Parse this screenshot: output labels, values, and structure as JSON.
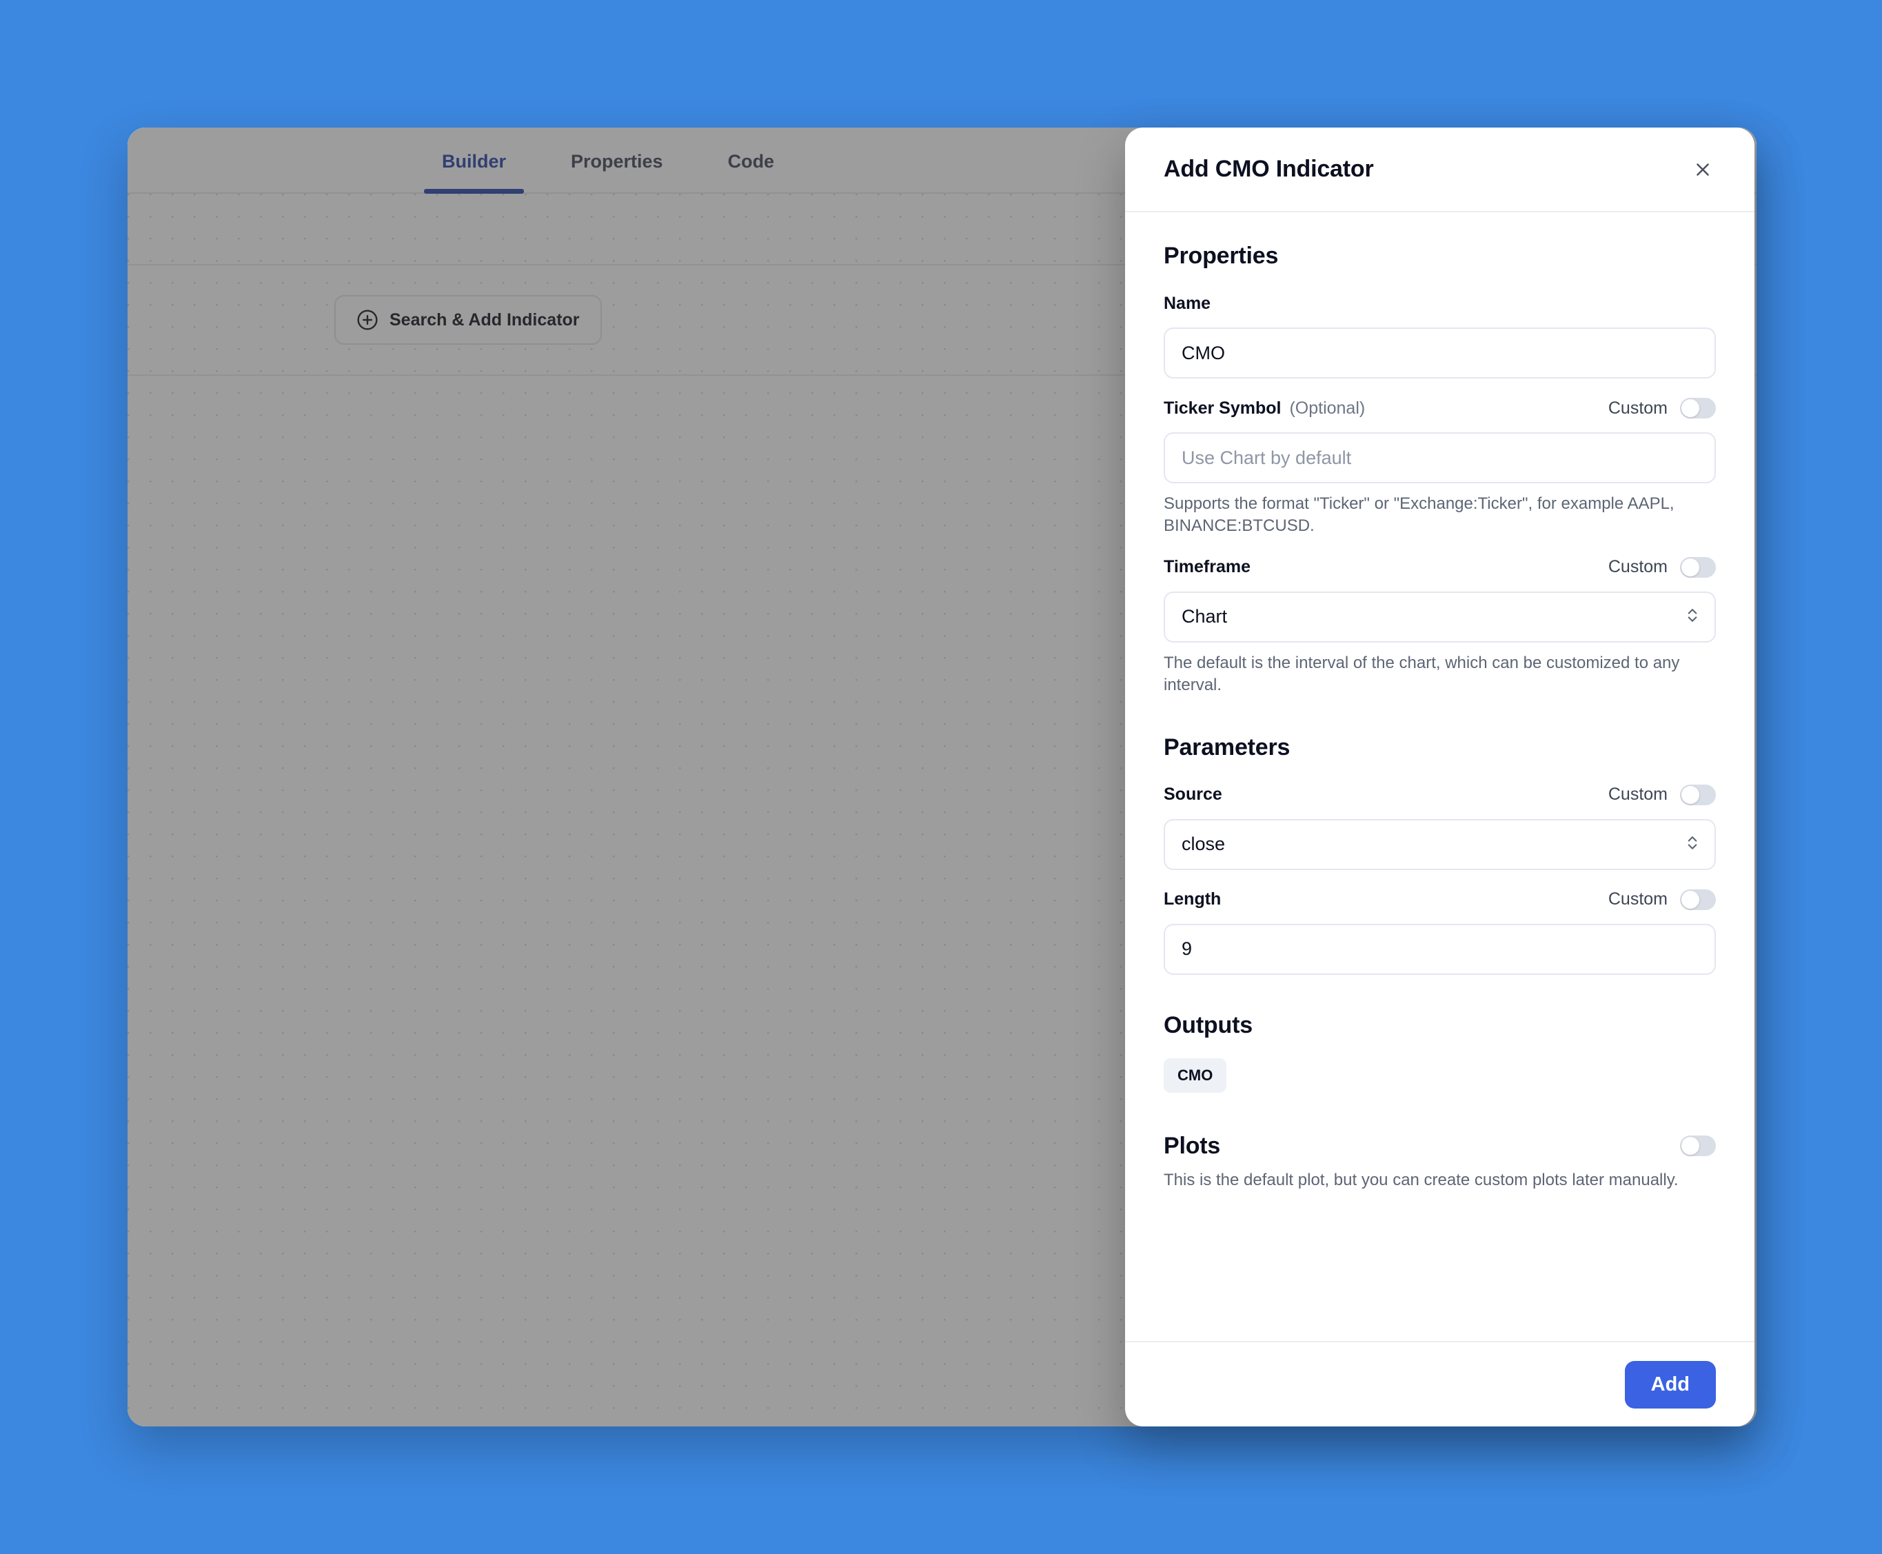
{
  "background_color": "#3c87df",
  "app": {
    "tabs": [
      {
        "label": "Builder",
        "active": true
      },
      {
        "label": "Properties",
        "active": false
      },
      {
        "label": "Code",
        "active": false
      }
    ],
    "add_row_icon": "+",
    "search_add_button": "Search & Add Indicator"
  },
  "dialog": {
    "title": "Add CMO Indicator",
    "close_label": "✕",
    "properties": {
      "heading": "Properties",
      "name": {
        "label": "Name",
        "value": "CMO"
      },
      "ticker": {
        "label": "Ticker Symbol",
        "optional": "(Optional)",
        "custom_label": "Custom",
        "custom_on": false,
        "placeholder": "Use Chart by default",
        "value": "",
        "help": "Supports the format \"Ticker\" or \"Exchange:Ticker\", for example AAPL, BINANCE:BTCUSD."
      },
      "timeframe": {
        "label": "Timeframe",
        "custom_label": "Custom",
        "custom_on": false,
        "value": "Chart",
        "help": "The default is the interval of the chart, which can be customized to any interval."
      }
    },
    "parameters": {
      "heading": "Parameters",
      "source": {
        "label": "Source",
        "custom_label": "Custom",
        "custom_on": false,
        "value": "close"
      },
      "length": {
        "label": "Length",
        "custom_label": "Custom",
        "custom_on": false,
        "value": "9"
      }
    },
    "outputs": {
      "heading": "Outputs",
      "items": [
        "CMO"
      ]
    },
    "plots": {
      "heading": "Plots",
      "enabled": false,
      "help": "This is the default plot, but you can create custom plots later manually."
    },
    "footer": {
      "add_label": "Add"
    }
  }
}
